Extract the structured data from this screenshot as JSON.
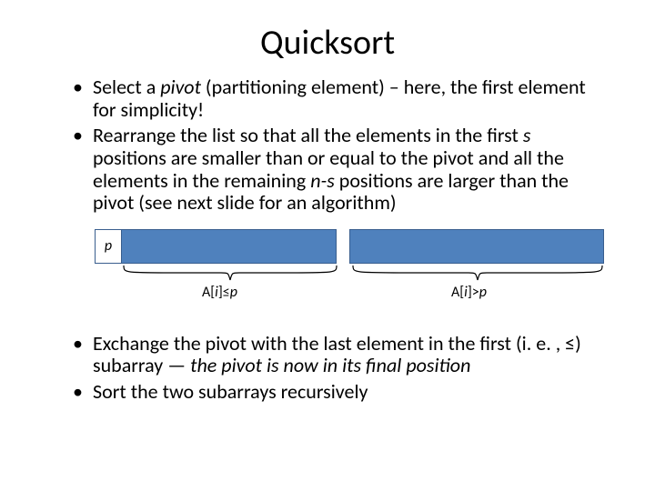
{
  "title": "Quicksort",
  "bullets": {
    "b1_pre": "Select a ",
    "b1_pivot": "pivot",
    "b1_post": " (partitioning element) – here, the first element for simplicity!",
    "b2_a": "Rearrange the list so that all the elements in the first ",
    "b2_s": "s",
    "b2_b": " positions are smaller than or equal to the pivot and all the elements in the remaining ",
    "b2_ns": "n-s",
    "b2_c": " positions are larger than the pivot (see next slide for an algorithm)",
    "b3_a": "Exchange the pivot with the last element in the first (i. e. , ≤) subarray — ",
    "b3_b": "the pivot is now in its final position",
    "b4": "Sort the two subarrays recursively"
  },
  "diagram": {
    "pivot": "p",
    "left_label_a": "A[",
    "left_label_i": "i",
    "left_label_b": "]≤",
    "left_label_p": "p",
    "right_label_a": "A[",
    "right_label_i": "i",
    "right_label_b": "]>",
    "right_label_p": "p"
  }
}
